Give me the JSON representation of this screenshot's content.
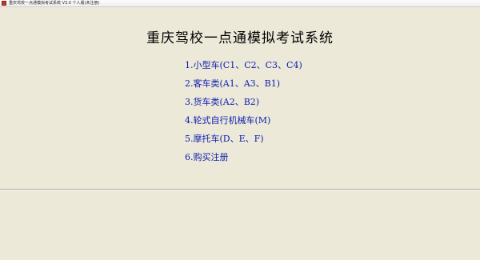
{
  "window": {
    "title": "重庆驾校一点通模拟考试系统 V3.0 个人版(未注册)",
    "icon": "app-icon"
  },
  "main": {
    "title": "重庆驾校一点通模拟考试系统",
    "menu": [
      {
        "label": "1.小型车(C1、C2、C3、C4)"
      },
      {
        "label": "2.客车类(A1、A3、B1)"
      },
      {
        "label": "3.货车类(A2、B2)"
      },
      {
        "label": "4.轮式自行机械车(M)"
      },
      {
        "label": "5.摩托车(D、E、F)"
      },
      {
        "label": "6.购买注册"
      }
    ]
  },
  "colors": {
    "background": "#ece9d8",
    "menu_link": "#0d1db0"
  }
}
